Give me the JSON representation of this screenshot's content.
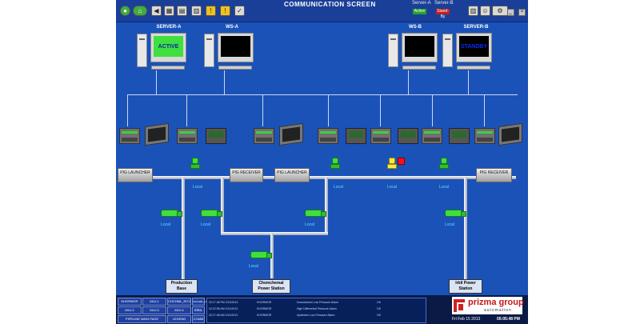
{
  "window": {
    "title": "COMMUNICATION SCREEN",
    "server_a_label": "Server-A",
    "server_b_label": "Server-B",
    "server_a_status": "Active",
    "server_b_status": "Stand-By"
  },
  "computers": {
    "server_a": {
      "label": "SERVER-A",
      "screen_text": "ACTIVE"
    },
    "ws_a": {
      "label": "WS-A",
      "screen_text": ""
    },
    "ws_b": {
      "label": "WS-B",
      "screen_text": ""
    },
    "server_b": {
      "label": "SERVER-B",
      "screen_text": "STANDBY"
    }
  },
  "pigs": {
    "launcher_1": "PIG LAUNCHER",
    "receiver_1": "PIG RECEIVER",
    "launcher_2": "PIG LAUNCHER",
    "receiver_2": "PIG RECEIVER"
  },
  "local_label": "Local",
  "stations": {
    "production_base": "Production Base",
    "chemchemal": "Chemchemal Power Station",
    "irbil": "Irbil Power Station"
  },
  "nav": {
    "b1": "KHORMOR",
    "b2": "MLV-1",
    "b3": "CHCHML_RCV",
    "b4": "CHCHML_LNC",
    "b5": "MLV-2",
    "b6": "MLV-3",
    "b7": "MLV-4",
    "b8": "IRBIL",
    "b9": "PIPELINE MAIN PAGE",
    "b10": "LEGEND",
    "b11": "COMM"
  },
  "alarms": [
    {
      "time": "02:17:48 PM 2/15/2013",
      "site": "KHORMOR",
      "msg": "Downstream Low Pressure Alarm",
      "state": "OK"
    },
    {
      "time": "02:22:55 AM 2/14/2013",
      "site": "KHORMOR",
      "msg": "High Differential Pressure Alarm",
      "state": "OK"
    },
    {
      "time": "02:17:48 AM 2/14/2013",
      "site": "KHORMOR",
      "msg": "Upstream Low Pressure Alarm",
      "state": "OK"
    }
  ],
  "brand": {
    "name": "prizma group",
    "sub": "automation"
  },
  "footer": {
    "date": "Fri Feb 15 2013",
    "time": "05:05:48 PM"
  },
  "colors": {
    "screen_bg": "#1a52b8",
    "valve_green": "#3fdf3f",
    "alarm_red": "#ff1010",
    "active_green": "#3fdf3f",
    "standby_blue": "#0a2aff"
  }
}
